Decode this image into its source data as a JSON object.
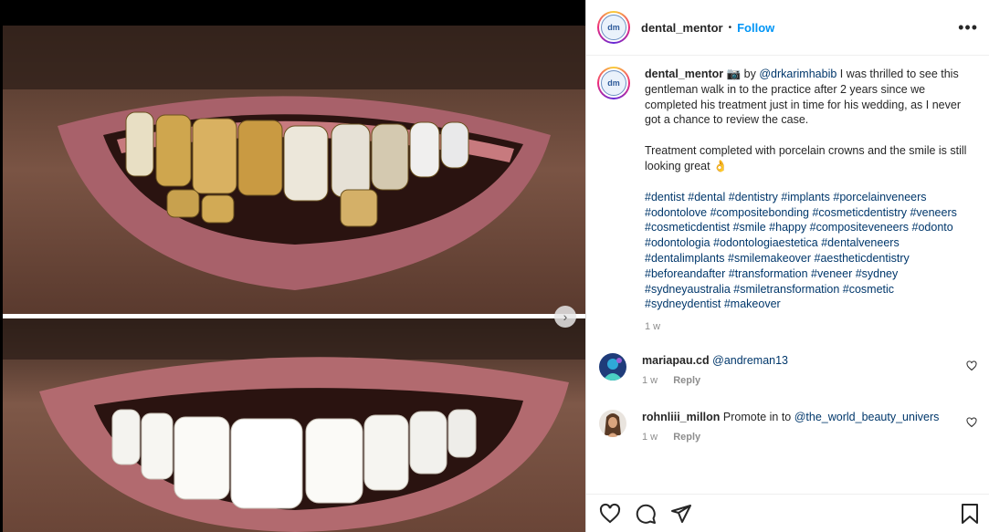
{
  "post": {
    "author": "dental_mentor",
    "separator": "•",
    "follow_label": "Follow",
    "more_icon": "more-horizontal-icon",
    "logo_text": "dm"
  },
  "caption": {
    "author": "dental_mentor",
    "camera_emoji": "📷",
    "by": " by ",
    "mention": "@drkarimhabib",
    "text1": " I was thrilled to see this gentleman walk in to the practice after 2 years since we completed his treatment just in time for his wedding, as I never got a chance to review the case.",
    "text2": "Treatment completed with porcelain crowns and the smile is still looking great 👌",
    "hashtags": "#dentist #dental #dentistry #implants #porcelainveneers #odontolove #compositebonding #cosmeticdentistry #veneers #cosmeticdentist #smile #happy #compositeveneers #odonto #odontologia #odontologiaestetica #dentalveneers #dentalimplants #smilemakeover #aestheticdentistry #beforeandafter #transformation #veneer #sydney #sydneyaustralia #smiletransformation #cosmetic #sydneydentist #makeover",
    "time": "1 w"
  },
  "comments": [
    {
      "user": "mariapau.cd",
      "text_plain": "",
      "mention": "@andreman13",
      "time": "1 w",
      "reply": "Reply"
    },
    {
      "user": "rohnliii_millon",
      "text_plain": "Promote in to ",
      "mention": "@the_world_beauty_univers",
      "time": "1 w",
      "reply": "Reply"
    }
  ],
  "actions": {
    "like_icon": "heart-icon",
    "comment_icon": "comment-icon",
    "share_icon": "send-icon",
    "save_icon": "bookmark-icon"
  },
  "colors": {
    "link": "#00376b",
    "follow": "#0095f6",
    "muted": "#8e8e8e"
  }
}
